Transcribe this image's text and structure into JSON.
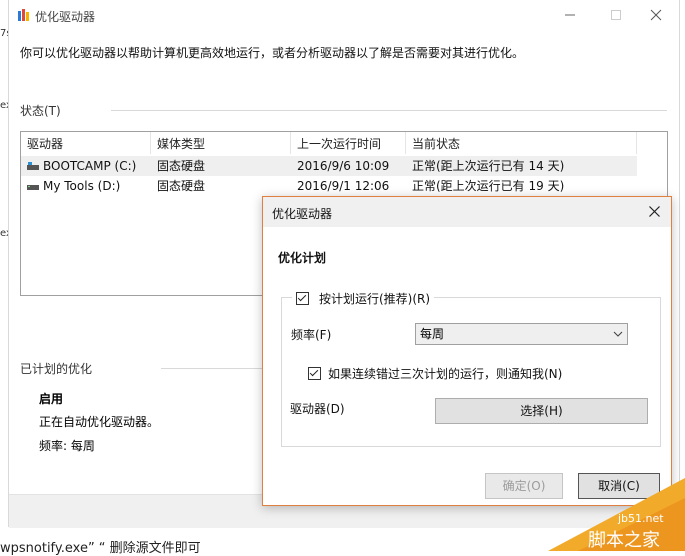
{
  "background_fragments": {
    "left_chars": [
      "7s",
      "ex",
      "ex"
    ],
    "footer": "wpsnotify.exe” “ 删除源文件即可"
  },
  "main_window": {
    "title": "优化驱动器",
    "description": "你可以优化驱动器以帮助计算机更高效地运行，或者分析驱动器以了解是否需要对其进行优化。",
    "status_label": "状态(T)",
    "columns": [
      "驱动器",
      "媒体类型",
      "上一次运行时间",
      "当前状态"
    ],
    "rows": [
      {
        "drive": "BOOTCAMP (C:)",
        "media": "固态硬盘",
        "last_run": "2016/9/6 10:09",
        "status": "正常(距上次运行已有 14 天)",
        "selected": true
      },
      {
        "drive": "My Tools (D:)",
        "media": "固态硬盘",
        "last_run": "2016/9/1 12:06",
        "status": "正常(距上次运行已有 19 天)",
        "selected": false
      }
    ],
    "scheduled_label": "已计划的优化",
    "scheduled_state": "启用",
    "scheduled_desc": "正在自动优化驱动器。",
    "scheduled_freq": "频率: 每周"
  },
  "dialog": {
    "title": "优化驱动器",
    "heading": "优化计划",
    "run_on_schedule": {
      "label": "按计划运行(推荐)(R)",
      "checked": true
    },
    "frequency_label": "频率(F)",
    "frequency_value": "每周",
    "notify": {
      "label": "如果连续错过三次计划的运行，则通知我(N)",
      "checked": true
    },
    "drives_label": "驱动器(D)",
    "choose_button": "选择(H)",
    "ok_button": "确定(O)",
    "cancel_button": "取消(C)"
  },
  "watermark": {
    "url": "jb51.net",
    "name": "脚本之家"
  },
  "colors": {
    "dialog_border": "#e08040",
    "watermark": "#f2aa2a"
  }
}
